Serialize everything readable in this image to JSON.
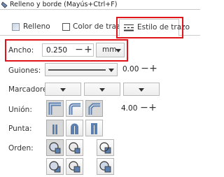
{
  "window": {
    "title": "Relleno y borde (Mayús+Ctrl+F)"
  },
  "tabs": [
    {
      "label": "Relleno"
    },
    {
      "label": "Color de trazo"
    },
    {
      "label": "Estilo de trazo",
      "active": true
    }
  ],
  "width_row": {
    "label": "Ancho:",
    "value": "0.250",
    "minus": "−",
    "plus": "+",
    "unit": "mm"
  },
  "dashes_row": {
    "label": "Guiones:",
    "value": "0.00",
    "minus": "−",
    "plus": "+"
  },
  "markers_row": {
    "label": "Marcadores:"
  },
  "join_row": {
    "label": "Unión:",
    "value": "4.00",
    "minus": "−",
    "plus": "+",
    "options": [
      "miter-join-icon",
      "round-join-icon",
      "bevel-join-icon"
    ]
  },
  "cap_row": {
    "label": "Punta:",
    "options": [
      "butt-cap-icon",
      "round-cap-icon",
      "square-cap-icon"
    ]
  },
  "order_row": {
    "label": "Orden:",
    "options": [
      "fill-stroke-markers-icon",
      "stroke-fill-markers-icon",
      "fill-markers-stroke-icon",
      "markers-fill-stroke-icon",
      "stroke-markers-fill-icon",
      "markers-stroke-fill-icon"
    ]
  },
  "colors": {
    "highlight": "#e0151a",
    "icon_blue": "#5b7fae"
  }
}
